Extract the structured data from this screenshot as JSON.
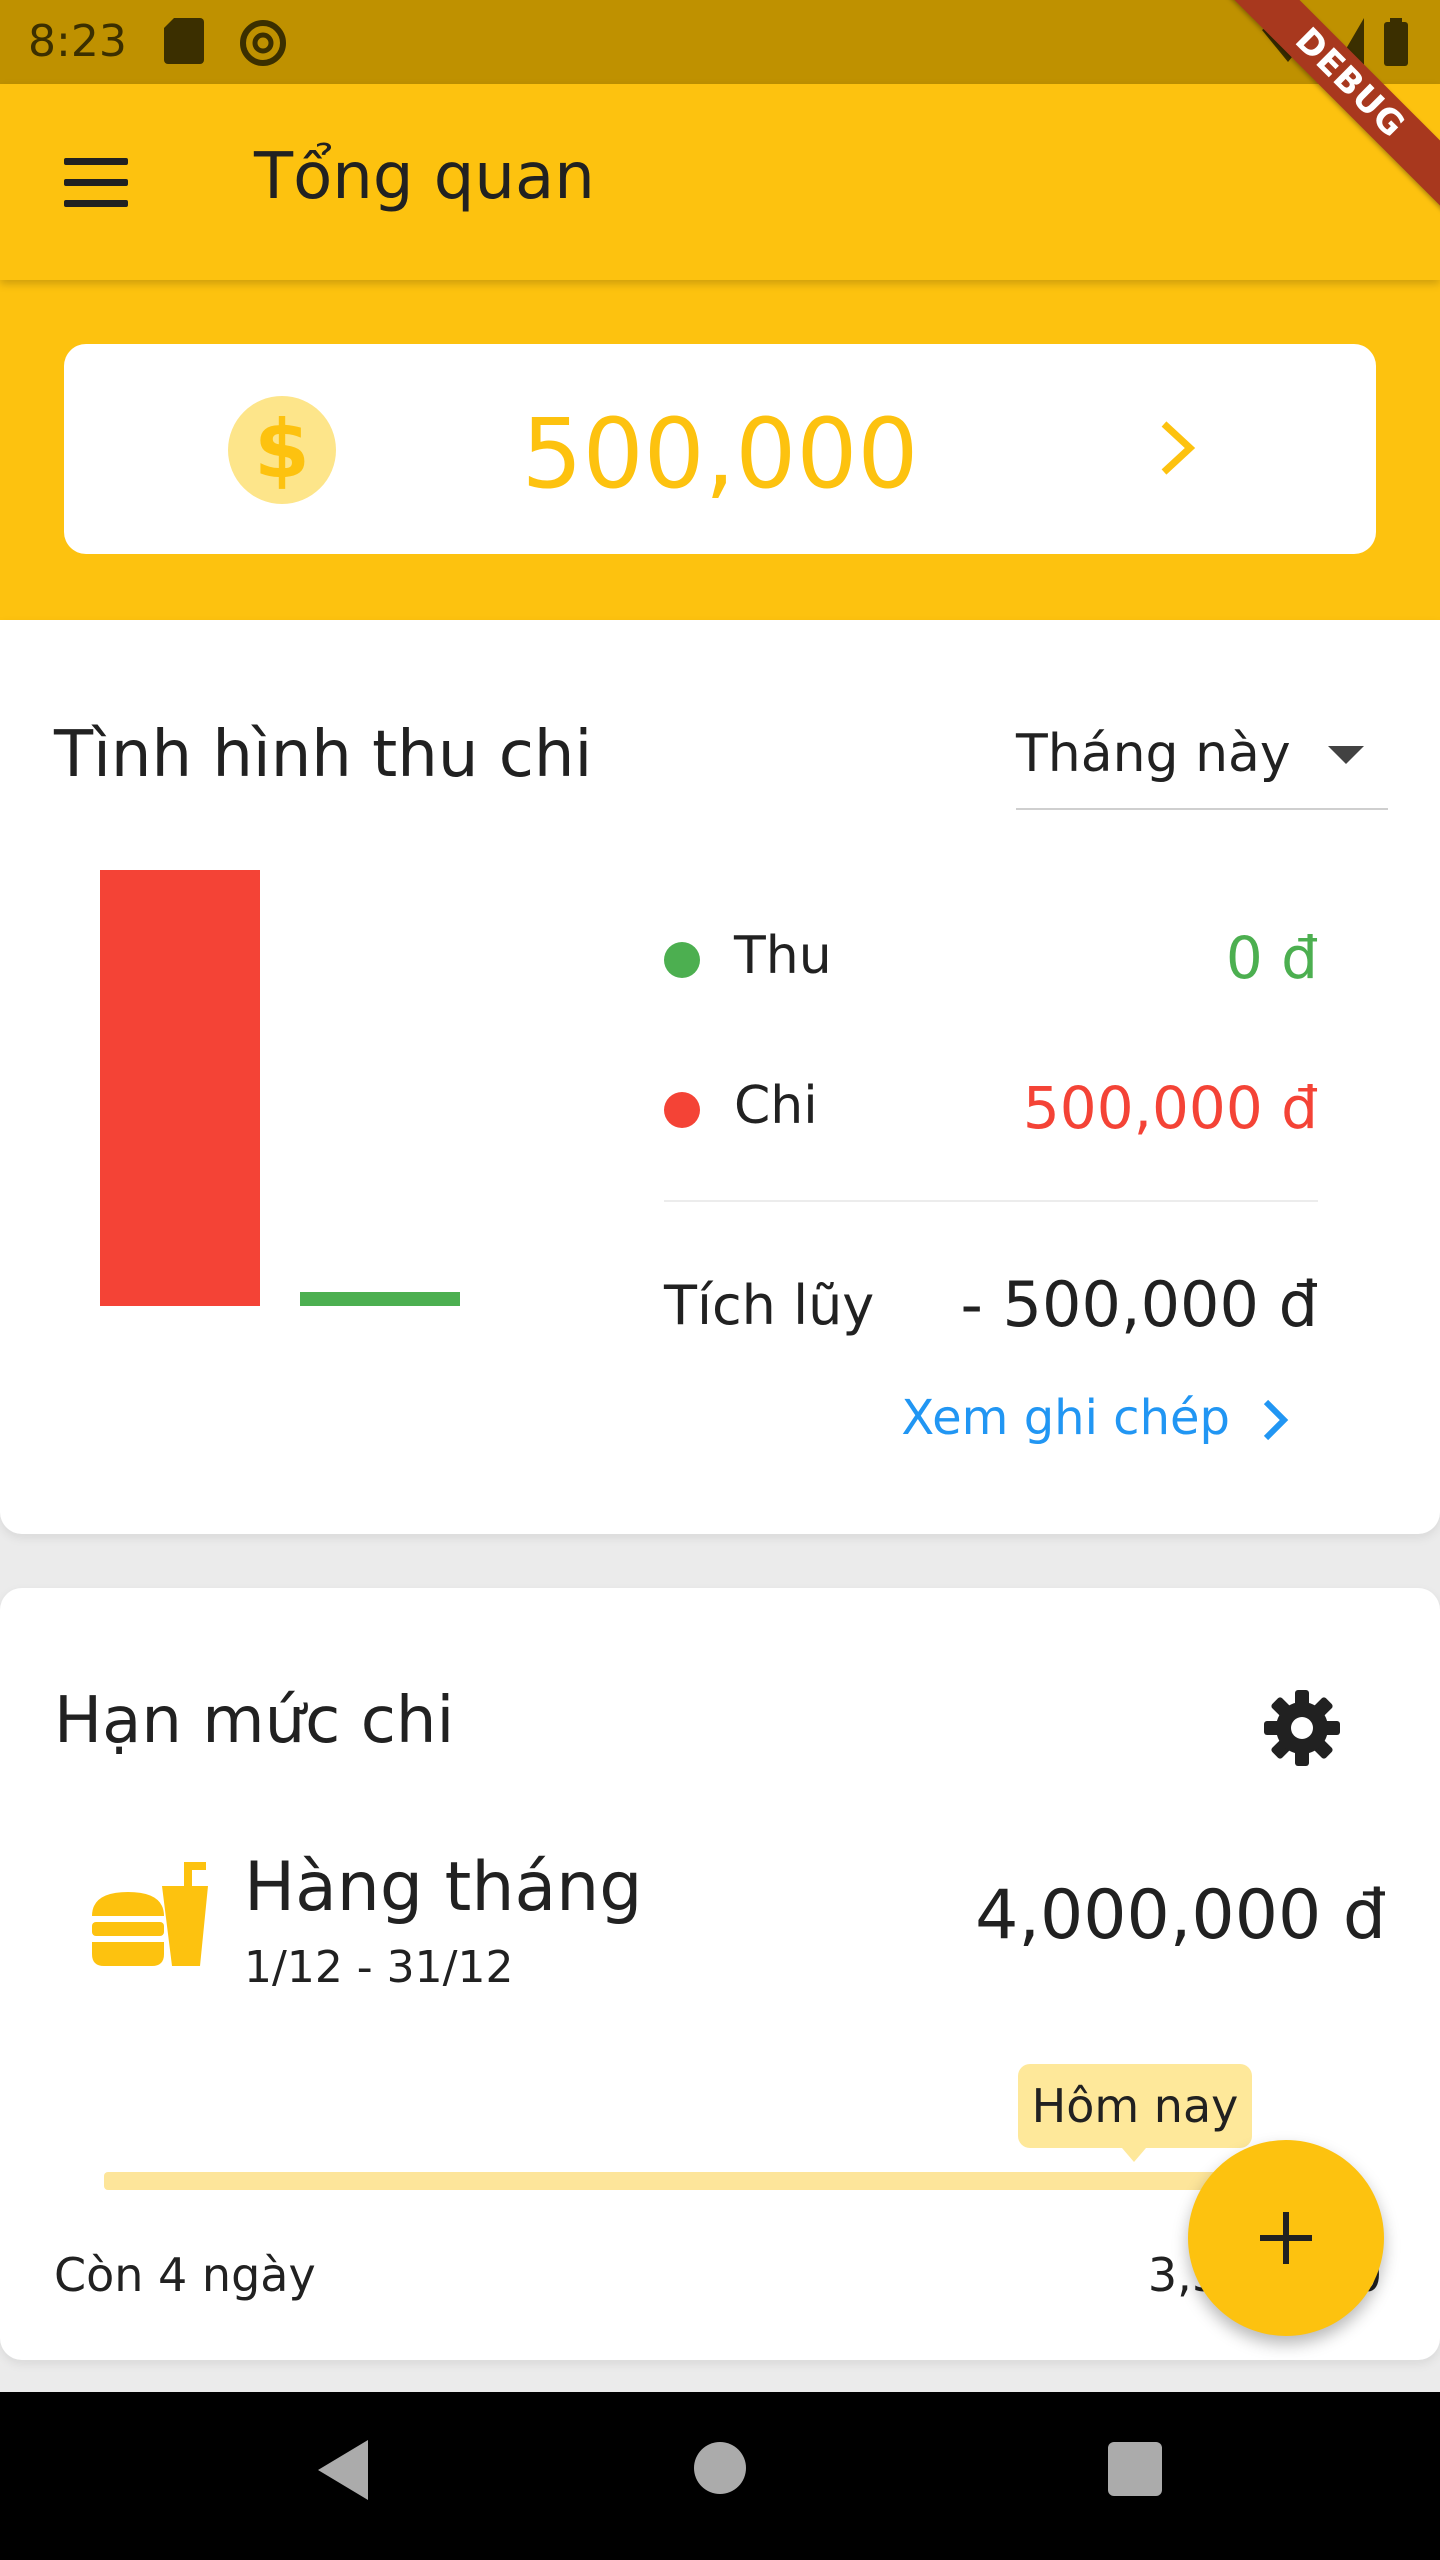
{
  "status_bar": {
    "time": "8:23"
  },
  "app_bar": {
    "title": "Tổng quan",
    "debug_label": "DEBUG"
  },
  "balance": {
    "currency_symbol": "$",
    "amount": "500,000"
  },
  "income_expense": {
    "title": "Tình hình thu chi",
    "period": "Tháng này",
    "income_label": "Thu",
    "income_value": "0 đ",
    "expense_label": "Chi",
    "expense_value": "500,000 đ",
    "accumulated_label": "Tích lũy",
    "accumulated_value": "- 500,000 đ",
    "view_records_label": "Xem ghi chép",
    "colors": {
      "income": "#4caf50",
      "expense": "#f44336"
    }
  },
  "chart_data": {
    "type": "bar",
    "categories": [
      "Chi",
      "Thu"
    ],
    "values": [
      500000,
      0
    ],
    "colors": [
      "#f44336",
      "#4caf50"
    ]
  },
  "budget": {
    "title": "Hạn mức chi",
    "name": "Hàng tháng",
    "dates": "1/12 - 31/12",
    "amount": "4,000,000 đ",
    "today_label": "Hôm nay",
    "days_left": "Còn 4 ngày",
    "remaining": "3,500,000",
    "icon": "fastfood-icon"
  },
  "accent_color": "#fdc20f"
}
